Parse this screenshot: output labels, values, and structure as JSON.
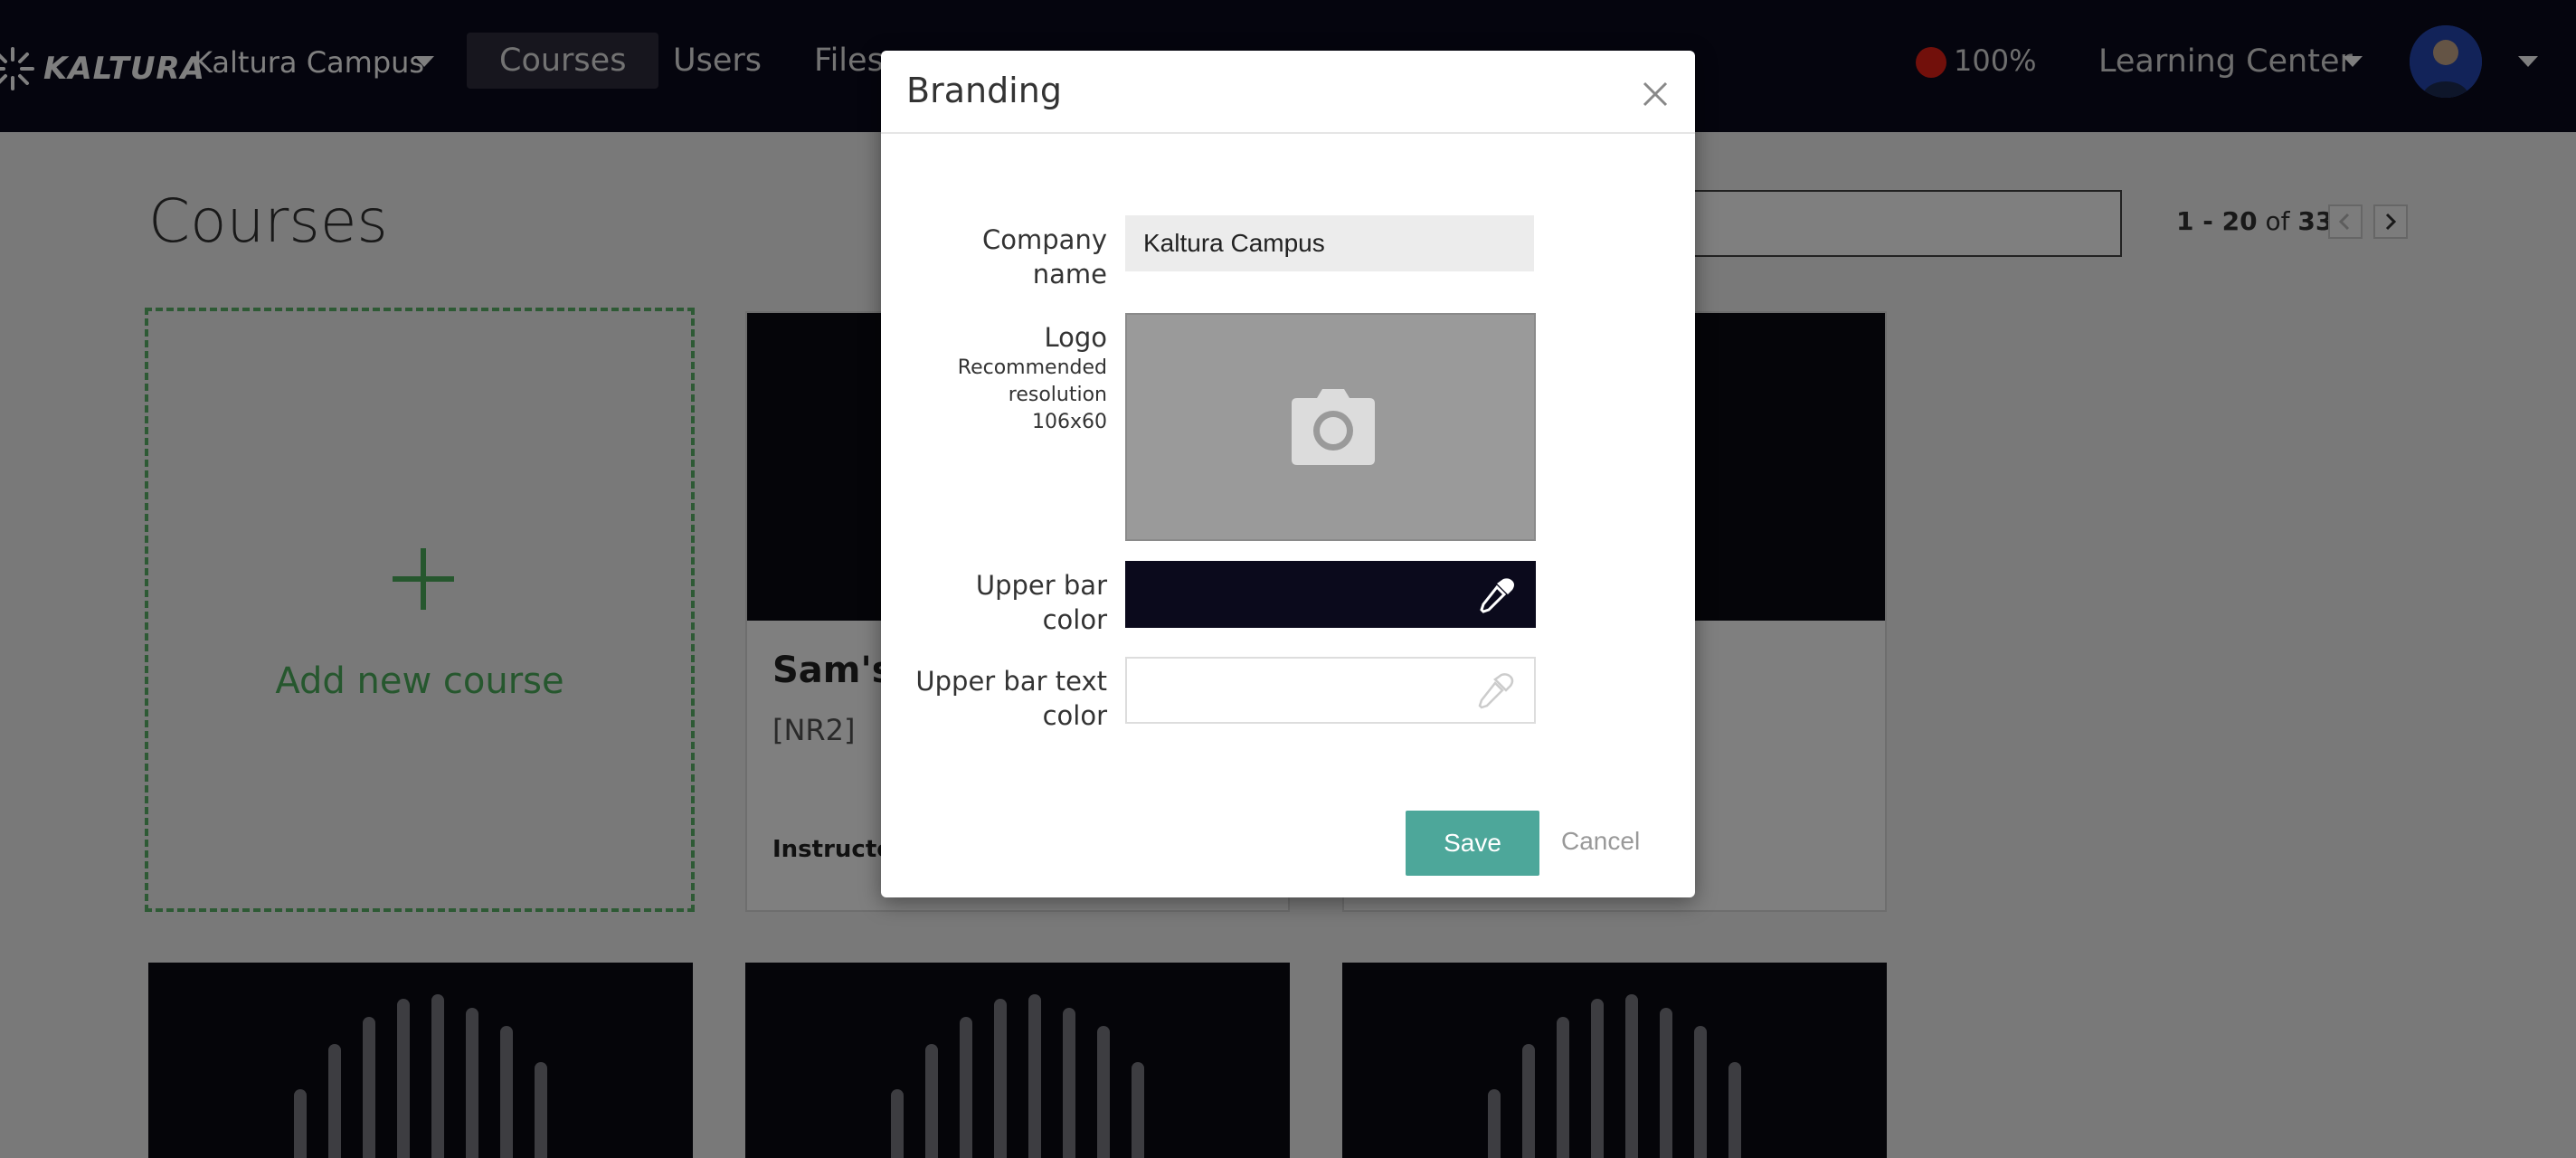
{
  "topbar": {
    "logo_text": "KALTURA",
    "campus": "Kaltura Campus",
    "nav": [
      {
        "label": "Courses",
        "active": true
      },
      {
        "label": "Users",
        "active": false
      },
      {
        "label": "Files",
        "active": false
      }
    ],
    "record_percent": "100%",
    "learning_center": "Learning Center"
  },
  "page": {
    "title": "Courses",
    "pager_range": "1 - 20",
    "pager_of": "of",
    "pager_total": "33"
  },
  "add_course": {
    "label": "Add new course"
  },
  "cards": [
    {
      "title": "Sam's",
      "code": "[NR2]",
      "instructor_label": "Instructor"
    }
  ],
  "modal": {
    "title": "Branding",
    "company_label_line1": "Company",
    "company_label_line2": "name",
    "company_value": "Kaltura Campus",
    "logo_label": "Logo",
    "logo_hint_line1": "Recommended",
    "logo_hint_line2": "resolution",
    "logo_hint_line3": "106x60",
    "upper_bar_label_line1": "Upper bar",
    "upper_bar_label_line2": "color",
    "upper_bar_color": "#0b0a1c",
    "upper_text_label_line1": "Upper bar text",
    "upper_text_label_line2": "color",
    "upper_text_color": "#ffffff",
    "save_label": "Save",
    "cancel_label": "Cancel"
  },
  "colors": {
    "topbar": "#0b0a1c",
    "accent_green": "#4caf5c",
    "save_button": "#4da79a",
    "record": "#e52117"
  },
  "icons": {
    "close": "close-icon",
    "camera": "camera-icon",
    "eyedropper": "eyedropper-icon",
    "chevron_left": "chevron-left-icon",
    "chevron_right": "chevron-right-icon"
  }
}
